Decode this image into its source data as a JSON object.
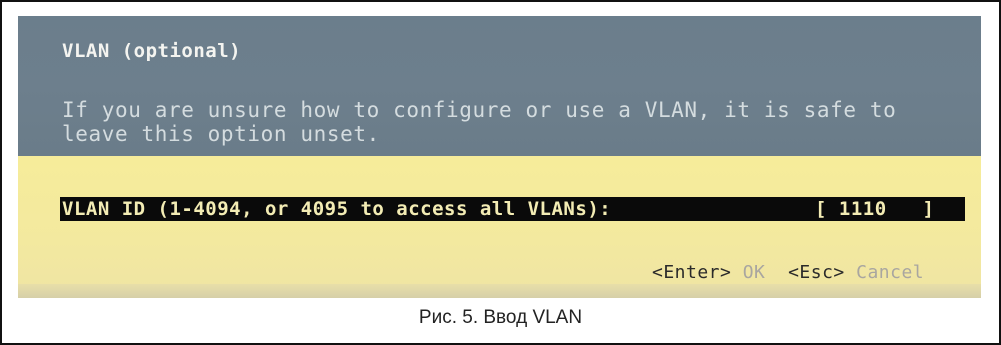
{
  "dialog": {
    "title": "VLAN (optional)",
    "help_line_1": "If you are unsure how to configure or use a VLAN, it is safe to",
    "help_line_2": "leave this option unset.",
    "field_label": "VLAN ID (1-4094, or 4095 to access all VLANs):",
    "field_value": "[ 1110   ]",
    "actions": {
      "ok_key": "<Enter>",
      "ok_label": "OK",
      "cancel_key": "<Esc>",
      "cancel_label": "Cancel"
    }
  },
  "caption": "Рис. 5. Ввод VLAN",
  "colors": {
    "header_bg": "#6b7e8c",
    "body_bg": "#f3e99f",
    "field_bg": "#0a0a0a",
    "field_text": "#f3ecb4"
  }
}
